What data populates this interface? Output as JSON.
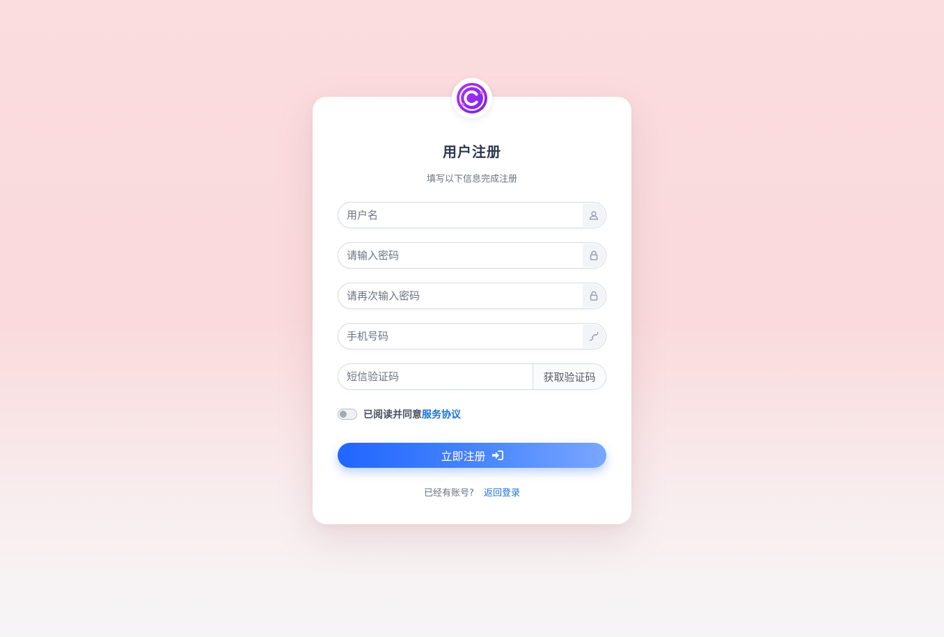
{
  "header": {
    "title": "用户注册",
    "subtitle": "填写以下信息完成注册"
  },
  "form": {
    "username": {
      "placeholder": "用户名",
      "icon": "user-icon"
    },
    "password": {
      "placeholder": "请输入密码",
      "icon": "lock-icon"
    },
    "confirm_password": {
      "placeholder": "请再次输入密码",
      "icon": "unlock-icon"
    },
    "phone": {
      "placeholder": "手机号码",
      "icon": "phone-icon"
    },
    "sms_code": {
      "placeholder": "短信验证码",
      "button_label": "获取验证码"
    }
  },
  "agreement": {
    "text": "已阅读并同意",
    "link": "服务协议",
    "checked": false
  },
  "submit": {
    "label": "立即注册",
    "icon": "sign-in-icon"
  },
  "footer": {
    "question": "已经有账号?",
    "link": "返回登录"
  },
  "colors": {
    "primary": "#2066ff",
    "link": "#1b72d8",
    "logo": "#9b2ff0"
  }
}
